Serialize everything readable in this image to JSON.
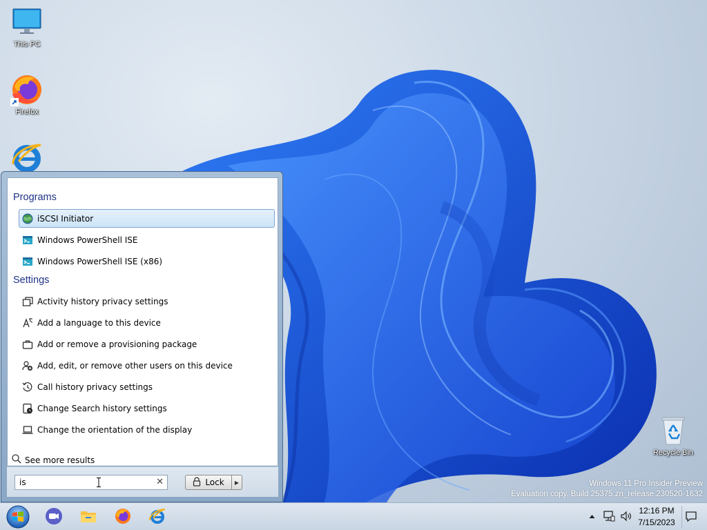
{
  "desktop": {
    "icons": [
      {
        "label": "This PC",
        "icon": "monitor-icon"
      },
      {
        "label": "Firefox",
        "icon": "firefox-icon"
      },
      {
        "label": "",
        "icon": "internet-explorer-icon"
      },
      {
        "label": "Recycle Bin",
        "icon": "recycle-bin-icon"
      }
    ],
    "watermark": {
      "line1": "Windows 11 Pro Insider Preview",
      "line2": "Evaluation copy. Build 25375.zn_release.230520-1632"
    }
  },
  "start_menu": {
    "programs_title": "Programs",
    "programs": [
      {
        "label": "iSCSI Initiator",
        "icon": "iscsi-globe-icon",
        "selected": true
      },
      {
        "label": "Windows PowerShell ISE",
        "icon": "powershell-ise-icon"
      },
      {
        "label": "Windows PowerShell ISE (x86)",
        "icon": "powershell-ise-icon"
      }
    ],
    "settings_title": "Settings",
    "settings": [
      {
        "label": "Activity history privacy settings",
        "icon": "windows-stack-icon"
      },
      {
        "label": "Add a language to this device",
        "icon": "language-icon"
      },
      {
        "label": "Add or remove a provisioning package",
        "icon": "briefcase-icon"
      },
      {
        "label": "Add, edit, or remove other users on this device",
        "icon": "user-add-icon"
      },
      {
        "label": "Call history privacy settings",
        "icon": "history-icon"
      },
      {
        "label": "Change Search history settings",
        "icon": "search-history-icon"
      },
      {
        "label": "Change the orientation of the display",
        "icon": "laptop-icon"
      }
    ],
    "see_more": "See more results",
    "search": {
      "value": "is"
    },
    "lock_label": "Lock"
  },
  "taskbar": {
    "apps": [
      "meet-camera-icon",
      "file-explorer-icon",
      "firefox-icon",
      "internet-explorer-icon"
    ],
    "clock": {
      "time": "12:16 PM",
      "date": "7/15/2023"
    }
  }
}
